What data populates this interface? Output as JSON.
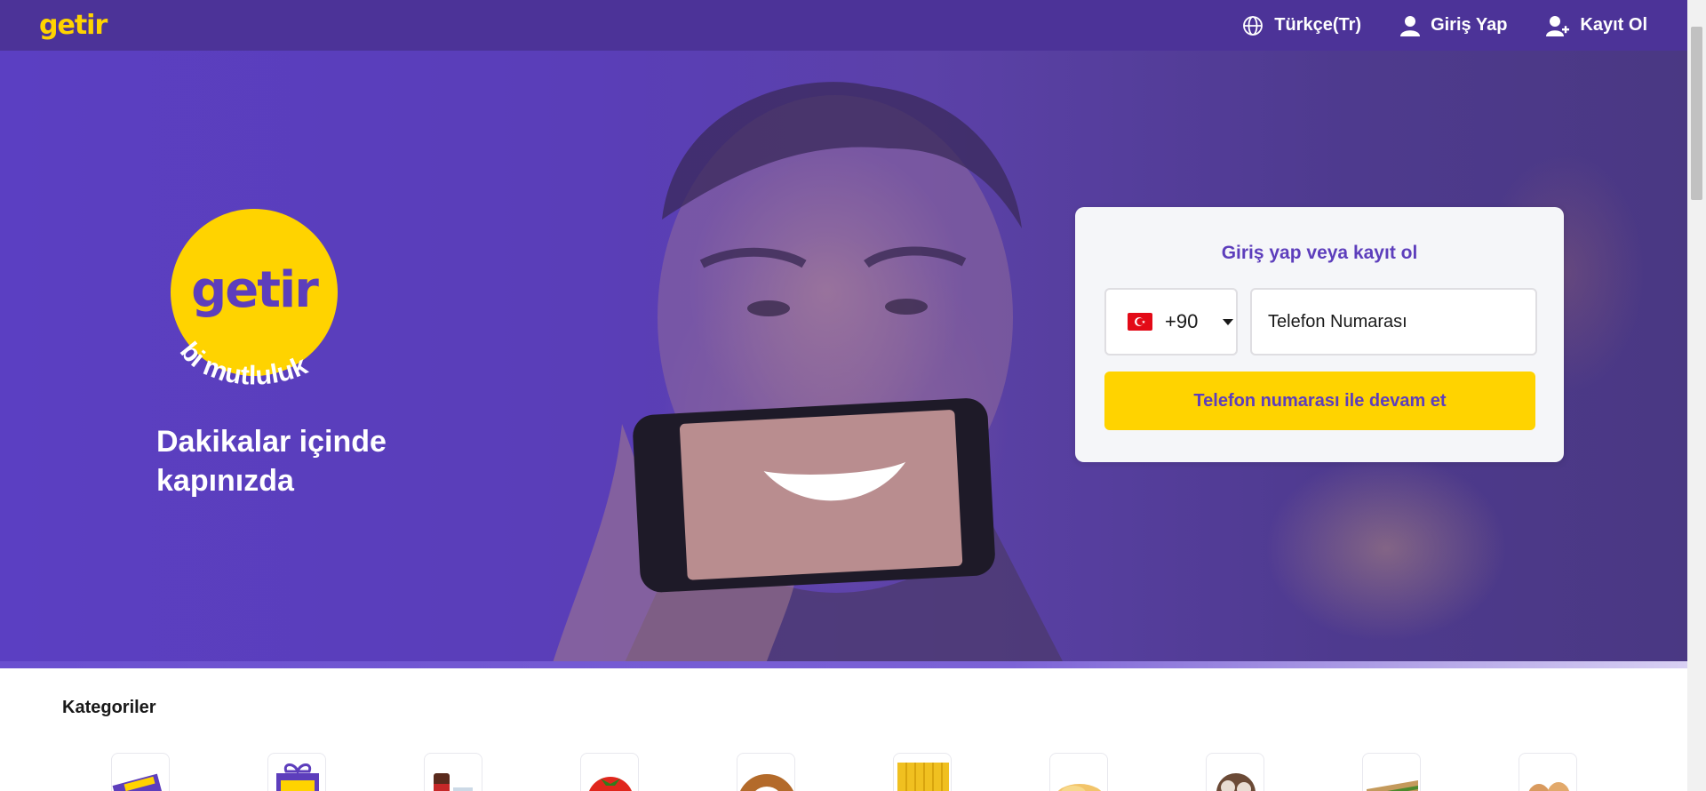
{
  "header": {
    "brand": "getir",
    "language_label": "Türkçe(Tr)",
    "login_label": "Giriş Yap",
    "signup_label": "Kayıt Ol"
  },
  "hero": {
    "logo_text": "getir",
    "tagline": "bi mutluluk",
    "title": "Dakikalar içinde kapınızda"
  },
  "login_card": {
    "title": "Giriş yap veya kayıt ol",
    "country_code": "+90",
    "phone_placeholder": "Telefon Numarası",
    "continue_label": "Telefon numarası ile devam et"
  },
  "categories": {
    "title": "Kategoriler",
    "items": [
      {
        "icon": "yeni-badge-icon"
      },
      {
        "icon": "gift-percent-icon"
      },
      {
        "icon": "drink-icon"
      },
      {
        "icon": "tomato-icon"
      },
      {
        "icon": "bread-icon"
      },
      {
        "icon": "pasta-icon"
      },
      {
        "icon": "chips-icon"
      },
      {
        "icon": "ice-cream-icon"
      },
      {
        "icon": "sandwich-icon"
      },
      {
        "icon": "eggs-icon"
      }
    ]
  },
  "colors": {
    "brand_purple": "#5d3ebc",
    "brand_yellow": "#ffd300",
    "header_bg": "#4c3398"
  }
}
